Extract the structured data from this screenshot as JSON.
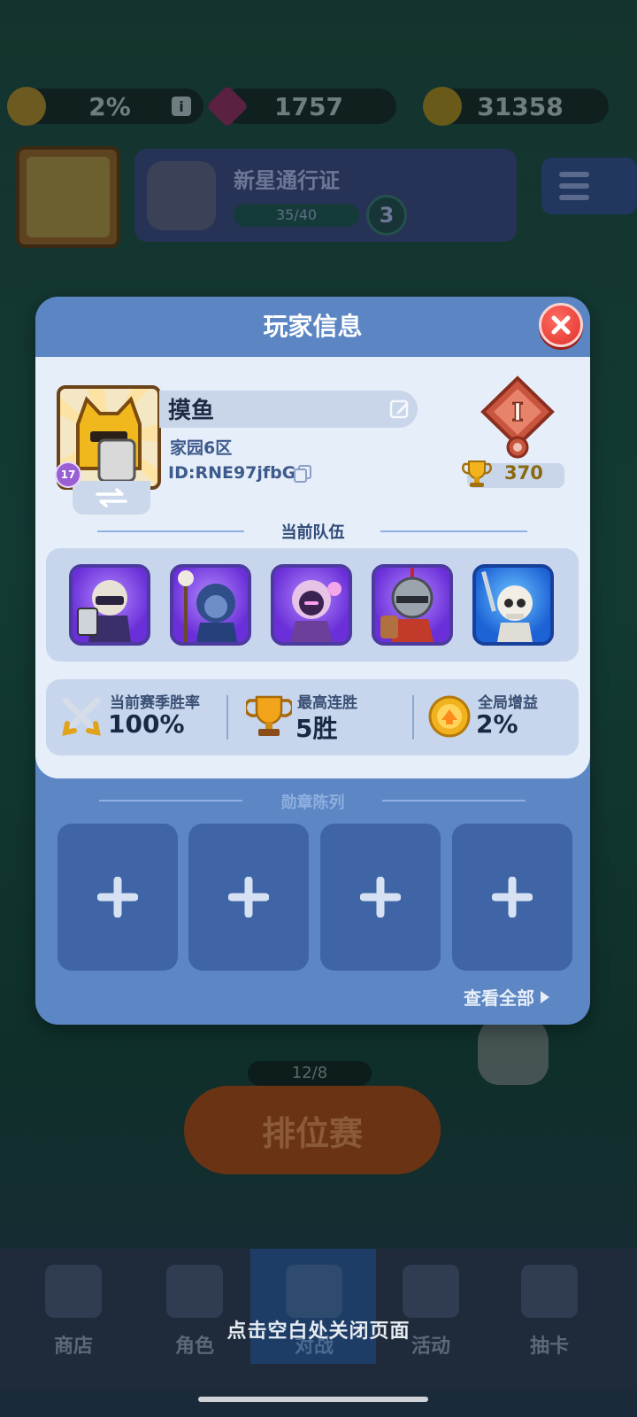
{
  "background": {
    "resources": {
      "boost_percent": "2%",
      "gems": "1757",
      "coins": "31358"
    },
    "pass": {
      "title": "新星通行证",
      "progress": "35/40",
      "level": "3"
    },
    "player_level": "17",
    "ranked": {
      "ticket": "12/8",
      "button_label": "排位赛"
    },
    "nav": {
      "shop": "商店",
      "characters": "角色",
      "battle": "对战",
      "events": "活动",
      "draw": "抽卡"
    }
  },
  "modal": {
    "title": "玩家信息",
    "player": {
      "name": "摸鱼",
      "region": "家园6区",
      "id": "ID:RNE97jfbGs",
      "level": "17",
      "rank_letter": "I",
      "trophies": "370"
    },
    "team_title": "当前队伍",
    "team": [
      {
        "name": "dark-knight-hero",
        "rarity": "purple"
      },
      {
        "name": "skull-staff-mage-hero",
        "rarity": "purple"
      },
      {
        "name": "shadow-ninja-hero",
        "rarity": "purple"
      },
      {
        "name": "helmet-knight-hero",
        "rarity": "purple"
      },
      {
        "name": "skeleton-warrior-hero",
        "rarity": "blue"
      }
    ],
    "stats": {
      "win_rate_label": "当前赛季胜率",
      "win_rate_value": "100%",
      "streak_label": "最高连胜",
      "streak_value": "5胜",
      "boost_label": "全局增益",
      "boost_value": "2%"
    },
    "medals_title": "勋章陈列",
    "medal_slots": 4,
    "view_all": "查看全部"
  },
  "close_hint": "点击空白处关闭页面",
  "colors": {
    "modal_blue": "#5c86c4",
    "card_white": "#e6eef9",
    "close_red": "#e0322b",
    "trophy_gold": "#8a6a10"
  }
}
